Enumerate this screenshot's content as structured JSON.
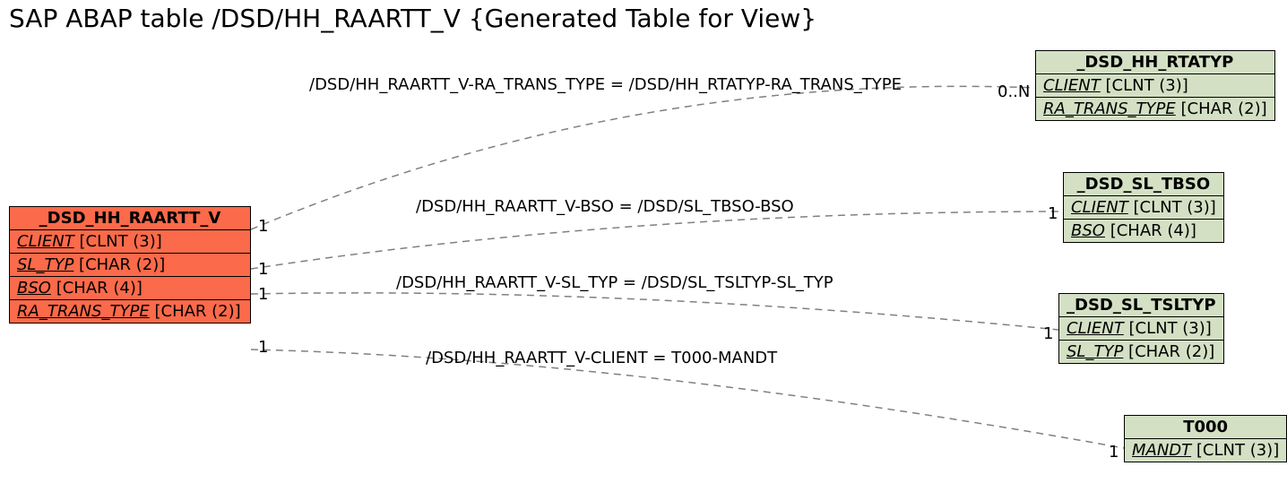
{
  "title": "SAP ABAP table /DSD/HH_RAARTT_V {Generated Table for View}",
  "main_entity": {
    "name": "_DSD_HH_RAARTT_V",
    "fields": [
      {
        "name": "CLIENT",
        "type": "[CLNT (3)]"
      },
      {
        "name": "SL_TYP",
        "type": "[CHAR (2)]"
      },
      {
        "name": "BSO",
        "type": "[CHAR (4)]"
      },
      {
        "name": "RA_TRANS_TYPE",
        "type": "[CHAR (2)]"
      }
    ]
  },
  "ref_entities": [
    {
      "name": "_DSD_HH_RTATYP",
      "fields": [
        {
          "name": "CLIENT",
          "type": "[CLNT (3)]"
        },
        {
          "name": "RA_TRANS_TYPE",
          "type": "[CHAR (2)]"
        }
      ]
    },
    {
      "name": "_DSD_SL_TBSO",
      "fields": [
        {
          "name": "CLIENT",
          "type": "[CLNT (3)]"
        },
        {
          "name": "BSO",
          "type": "[CHAR (4)]"
        }
      ]
    },
    {
      "name": "_DSD_SL_TSLTYP",
      "fields": [
        {
          "name": "CLIENT",
          "type": "[CLNT (3)]"
        },
        {
          "name": "SL_TYP",
          "type": "[CHAR (2)]"
        }
      ]
    },
    {
      "name": "T000",
      "fields": [
        {
          "name": "MANDT",
          "type": "[CLNT (3)]"
        }
      ]
    }
  ],
  "relations": [
    {
      "label": "/DSD/HH_RAARTT_V-RA_TRANS_TYPE = /DSD/HH_RTATYP-RA_TRANS_TYPE",
      "left_card": "1",
      "right_card": "0..N"
    },
    {
      "label": "/DSD/HH_RAARTT_V-BSO = /DSD/SL_TBSO-BSO",
      "left_card": "1",
      "right_card": "1"
    },
    {
      "label": "/DSD/HH_RAARTT_V-SL_TYP = /DSD/SL_TSLTYP-SL_TYP",
      "left_card": "1",
      "right_card": "1"
    },
    {
      "label": "/DSD/HH_RAARTT_V-CLIENT = T000-MANDT",
      "left_card": "1",
      "right_card": "1"
    }
  ]
}
